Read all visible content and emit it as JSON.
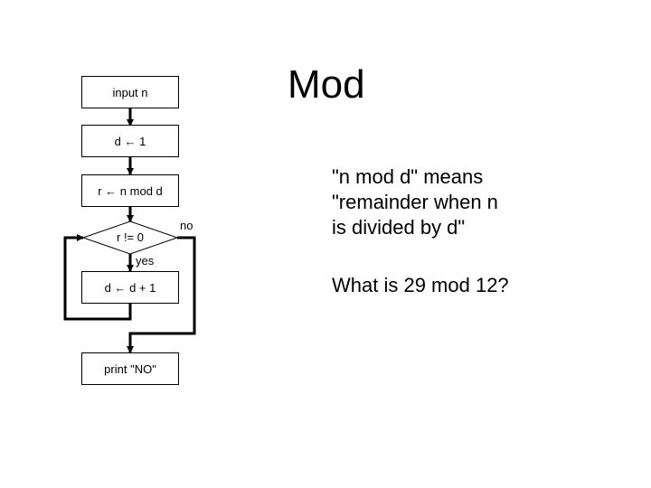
{
  "slide": {
    "title": "Mod",
    "description": "\"n mod d\" means \"remainder when n is divided by d\"",
    "description_lines": [
      "\"n mod d\" means",
      "\"remainder when n",
      "is divided by d\""
    ],
    "question": "What is 29 mod 12?"
  },
  "flowchart": {
    "nodes": {
      "input": "input n",
      "init": "d ← 1",
      "compute": "r ← n mod d",
      "decision": "r != 0",
      "increment": "d ← d + 1",
      "output": "print \"NO\""
    },
    "edge_labels": {
      "yes": "yes",
      "no": "no"
    }
  }
}
